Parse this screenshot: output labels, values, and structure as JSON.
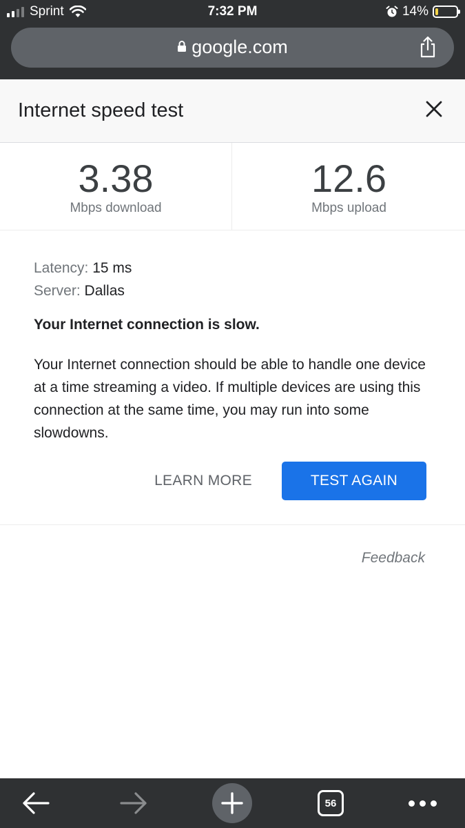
{
  "status_bar": {
    "carrier": "Sprint",
    "time": "7:32 PM",
    "battery_percent": "14%",
    "battery_level": 0.14,
    "signal_bars": 2
  },
  "browser": {
    "url": "google.com",
    "lock_icon": "lock-icon",
    "share_icon": "share-icon"
  },
  "card": {
    "title": "Internet speed test",
    "close_icon": "close-icon"
  },
  "results": {
    "download_value": "3.38",
    "download_label": "Mbps download",
    "upload_value": "12.6",
    "upload_label": "Mbps upload"
  },
  "details": {
    "latency_key": "Latency:",
    "latency_value": "15 ms",
    "server_key": "Server:",
    "server_value": "Dallas",
    "verdict": "Your Internet connection is slow.",
    "description": "Your Internet connection should be able to handle one device at a time streaming a video. If multiple devices are using this connection at the same time, you may run into some slowdowns."
  },
  "actions": {
    "learn_more": "LEARN MORE",
    "test_again": "TEST AGAIN",
    "feedback": "Feedback"
  },
  "toolbar": {
    "tab_count": "56"
  },
  "colors": {
    "accent": "#1a73e8",
    "chrome_bg": "#2f3133",
    "url_bar_bg": "#5f6368",
    "battery_low": "#f6d54a"
  }
}
